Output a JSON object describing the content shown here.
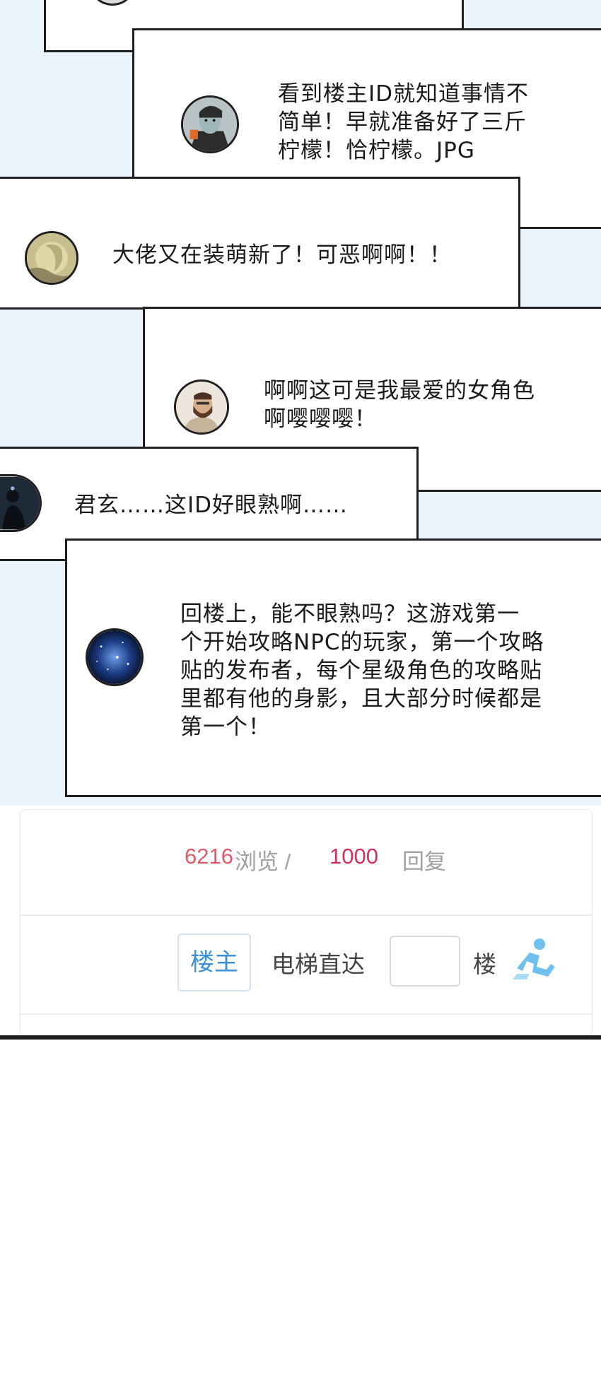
{
  "comments": [
    {
      "id": "c1",
      "text_lines": [
        "看到楼主ID就知道事情不",
        "简单！早就准备好了三斤",
        "柠檬！恰柠檬。JPG"
      ],
      "avatar": "comic-character-avatar"
    },
    {
      "id": "c2",
      "text_lines": [
        "大佬又在装萌新了！可恶啊啊！！"
      ],
      "avatar": "golden-moon-avatar"
    },
    {
      "id": "c3",
      "text_lines": [
        "啊啊这可是我最爱的女角色",
        "啊嘤嘤嘤！"
      ],
      "avatar": "bearded-man-avatar"
    },
    {
      "id": "c4",
      "text_lines": [
        "君玄……这ID好眼熟啊……"
      ],
      "avatar": "dark-figure-avatar"
    },
    {
      "id": "c5",
      "text_lines": [
        "回楼上，能不眼熟吗？这游戏第一",
        "个开始攻略NPC的玩家，第一个攻略",
        "贴的发布者，每个星级角色的攻略贴",
        "里都有他的身影，且大部分时候都是",
        "第一个！"
      ],
      "avatar": "galaxy-avatar"
    }
  ],
  "forum": {
    "views_count": "6216",
    "views_label": "浏览 /",
    "replies_count": "1000",
    "replies_label": "回复",
    "louzhu_button": "楼主",
    "elevator_label": "电梯直达",
    "floor_input_placeholder": "",
    "floor_unit": "楼",
    "jump_icon": "elevator-jump-icon"
  },
  "colors": {
    "background_blue": "#eaf3fb",
    "panel_border": "#1f1f1f",
    "views_count_color": "#e05a6a",
    "replies_count_color": "#d4305a",
    "label_gray": "#a0a0a0",
    "accent_blue": "#3a8fd6",
    "icon_blue": "#6fc0ee"
  }
}
